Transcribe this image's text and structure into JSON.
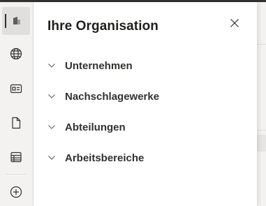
{
  "panel": {
    "title": "Ihre Organisation",
    "close_icon": "close-icon",
    "sections": [
      {
        "label": "Unternehmen",
        "icon": "chevron-down-icon",
        "expanded": false
      },
      {
        "label": "Nachschlagewerke",
        "icon": "chevron-down-icon",
        "expanded": false
      },
      {
        "label": "Abteilungen",
        "icon": "chevron-down-icon",
        "expanded": false
      },
      {
        "label": "Arbeitsbereiche",
        "icon": "chevron-down-icon",
        "expanded": false
      }
    ]
  },
  "rail": {
    "items": [
      {
        "icon": "organization-icon",
        "active": true
      },
      {
        "icon": "globe-icon",
        "active": false
      },
      {
        "icon": "contact-card-icon",
        "active": false
      },
      {
        "icon": "document-icon",
        "active": false
      },
      {
        "icon": "table-icon",
        "active": false
      },
      {
        "icon": "add-circle-icon",
        "active": false
      }
    ]
  },
  "colors": {
    "title_text": "#201f1e",
    "section_text": "#323130",
    "rail_background": "#f3f2f1",
    "active_indicator": "#323130",
    "panel_background": "#ffffff"
  }
}
